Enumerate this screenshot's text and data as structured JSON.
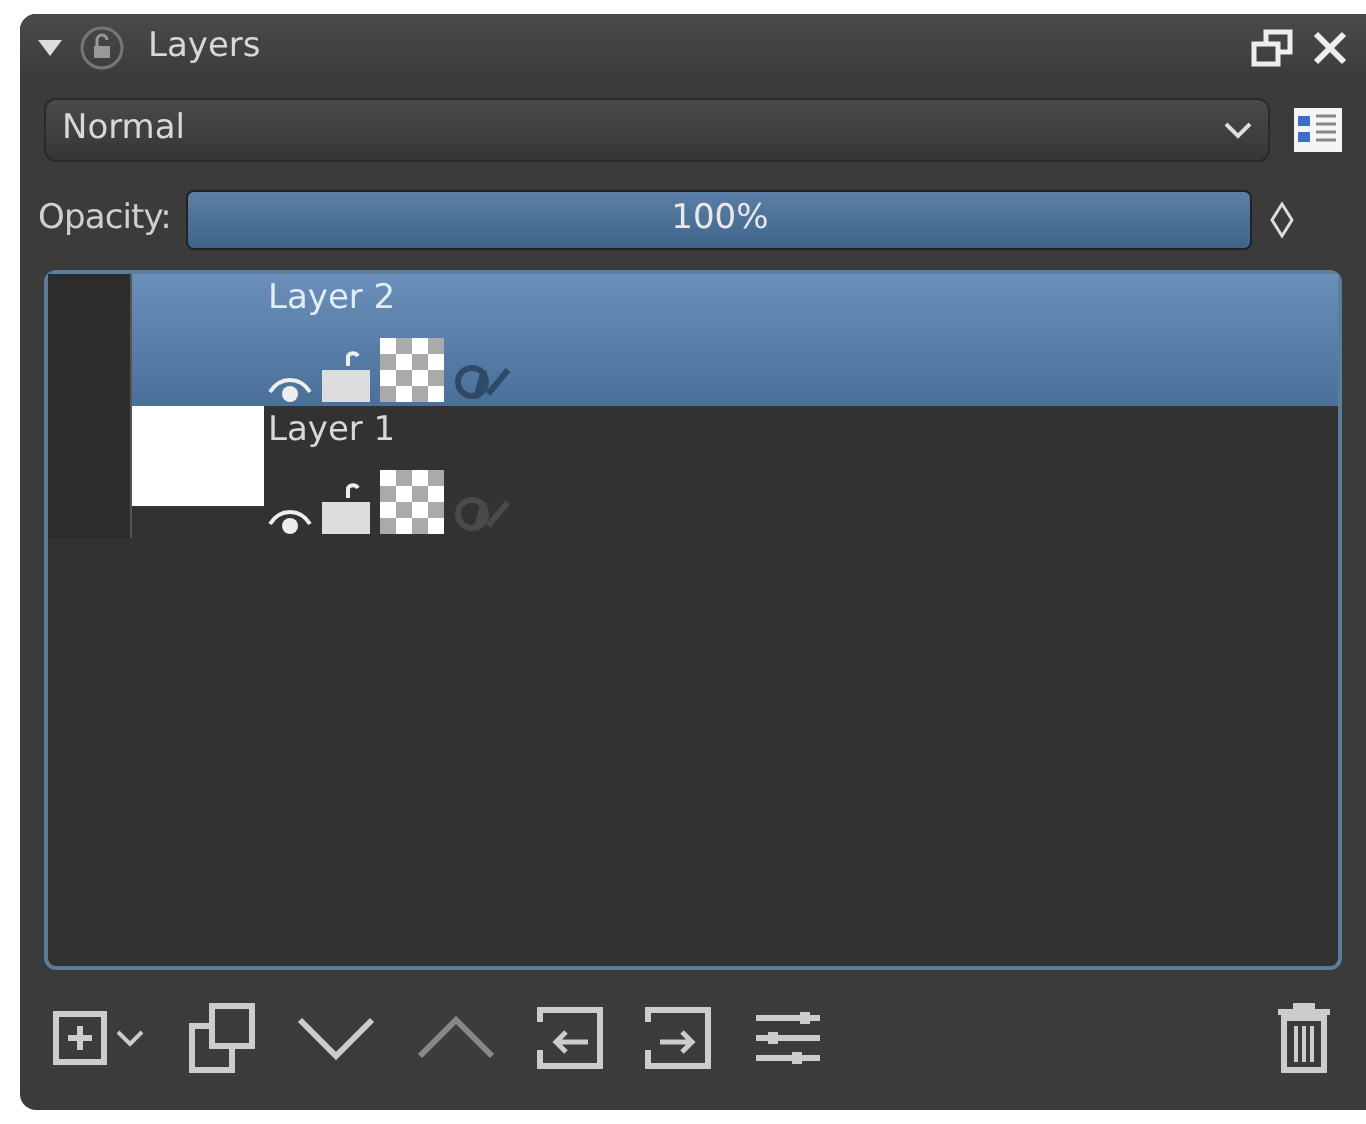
{
  "panel": {
    "title": "Layers"
  },
  "blend_mode": {
    "value": "Normal"
  },
  "opacity": {
    "label": "Opacity:",
    "reading": "100%",
    "level": 1
  },
  "layers": [
    {
      "name": "Layer 2",
      "selected": true,
      "kind": "transparent"
    },
    {
      "name": "Layer 1",
      "selected": false,
      "kind": "white"
    }
  ]
}
